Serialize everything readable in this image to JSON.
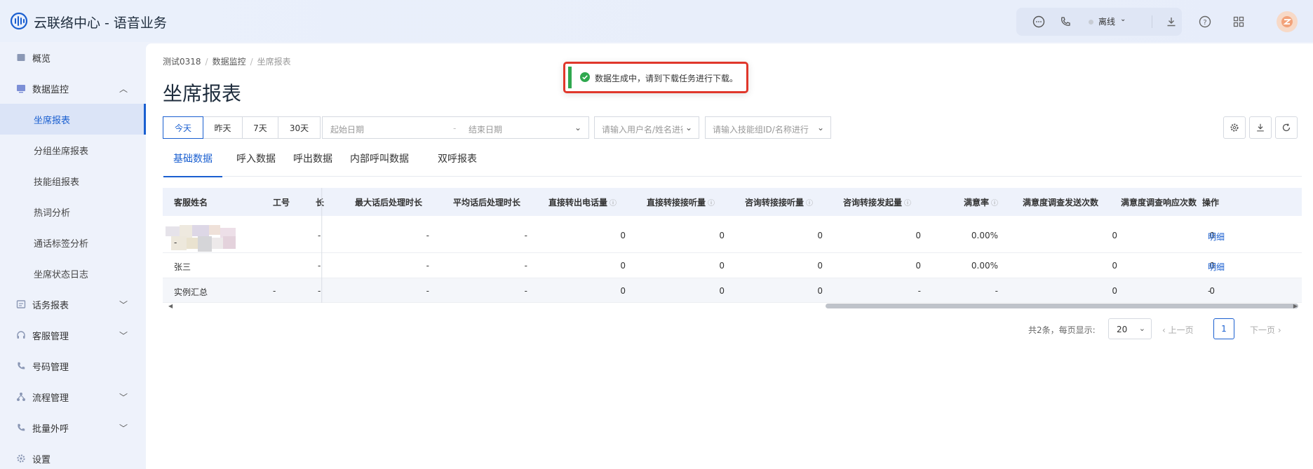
{
  "app": {
    "title": "云联络中心 - 语音业务"
  },
  "header": {
    "status_label": "离线",
    "icons": [
      "chat-icon",
      "phone-icon",
      "download-icon",
      "help-icon",
      "apps-icon"
    ]
  },
  "sidebar": {
    "items": [
      {
        "label": "概览",
        "icon": "overview-icon"
      },
      {
        "label": "数据监控",
        "icon": "monitor-icon",
        "expanded": true
      },
      {
        "label": "坐席报表",
        "active": true
      },
      {
        "label": "分组坐席报表"
      },
      {
        "label": "技能组报表"
      },
      {
        "label": "热词分析"
      },
      {
        "label": "通话标签分析"
      },
      {
        "label": "坐席状态日志"
      },
      {
        "label": "话务报表",
        "icon": "report-icon"
      },
      {
        "label": "客服管理",
        "icon": "headset-icon"
      },
      {
        "label": "号码管理",
        "icon": "phone-icon"
      },
      {
        "label": "流程管理",
        "icon": "flow-icon"
      },
      {
        "label": "批量外呼",
        "icon": "outbound-icon"
      },
      {
        "label": "设置",
        "icon": "settings-icon"
      }
    ]
  },
  "breadcrumb": {
    "items": [
      "测试0318",
      "数据监控",
      "坐席报表"
    ]
  },
  "page": {
    "title": "坐席报表"
  },
  "toast": {
    "message": "数据生成中，请到下载任务进行下载。"
  },
  "filters": {
    "date_buttons": [
      "今天",
      "昨天",
      "7天",
      "30天"
    ],
    "active_date": "今天",
    "start_placeholder": "起始日期",
    "range_separator": "-",
    "end_placeholder": "结束日期",
    "user_placeholder": "请输入用户名/姓名进行搜",
    "skill_placeholder": "请输入技能组ID/名称进行"
  },
  "tabs": [
    "基础数据",
    "呼入数据",
    "呼出数据",
    "内部呼叫数据",
    "双呼报表"
  ],
  "table": {
    "headers": {
      "name": "客服姓名",
      "id": "工号",
      "truncated": "长",
      "max_after": "最大话后处理时长",
      "avg_after": "平均话后处理时长",
      "direct_out": "直接转出电话量",
      "direct_in": "直接转接接听量",
      "consult_in": "咨询转接接听量",
      "consult_out": "咨询转接发起量",
      "satisfaction": "满意率",
      "survey_sent": "满意度调查发送次数",
      "survey_resp": "满意度调查响应次数",
      "action": "操作"
    },
    "rows": [
      {
        "name": "-",
        "id": "",
        "truncated": "-",
        "max_after": "-",
        "avg_after": "-",
        "direct_out": "0",
        "direct_in": "0",
        "consult_in": "0",
        "consult_out": "0",
        "satisfaction": "0.00%",
        "survey_sent": "0",
        "survey_resp": "0",
        "action": "明细"
      },
      {
        "name": "张三",
        "id": "",
        "truncated": "-",
        "max_after": "-",
        "avg_after": "-",
        "direct_out": "0",
        "direct_in": "0",
        "consult_in": "0",
        "consult_out": "0",
        "satisfaction": "0.00%",
        "survey_sent": "0",
        "survey_resp": "0",
        "action": "明细"
      },
      {
        "name": "实例汇总",
        "id": "-",
        "truncated": "-",
        "max_after": "-",
        "avg_after": "-",
        "direct_out": "0",
        "direct_in": "0",
        "consult_in": "0",
        "consult_out": "-",
        "satisfaction": "-",
        "survey_sent": "0",
        "survey_resp": "0",
        "action": "-"
      }
    ]
  },
  "pagination": {
    "total_text": "共2条，每页显示:",
    "page_size": "20",
    "prev_label": "上一页",
    "current_page": "1",
    "next_label": "下一页"
  }
}
